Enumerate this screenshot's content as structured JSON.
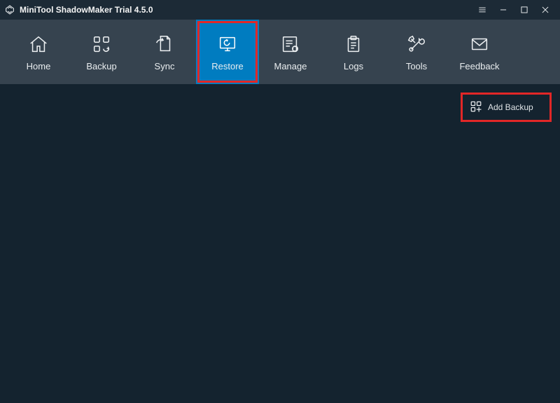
{
  "app": {
    "title": "MiniTool ShadowMaker Trial 4.5.0"
  },
  "nav": {
    "items": [
      {
        "label": "Home"
      },
      {
        "label": "Backup"
      },
      {
        "label": "Sync"
      },
      {
        "label": "Restore"
      },
      {
        "label": "Manage"
      },
      {
        "label": "Logs"
      },
      {
        "label": "Tools"
      },
      {
        "label": "Feedback"
      }
    ],
    "active_index": 3
  },
  "actions": {
    "add_backup_label": "Add Backup"
  },
  "colors": {
    "accent": "#007cc0",
    "highlight": "#e22727",
    "bg": "#14232f",
    "navbar": "#36434f"
  }
}
